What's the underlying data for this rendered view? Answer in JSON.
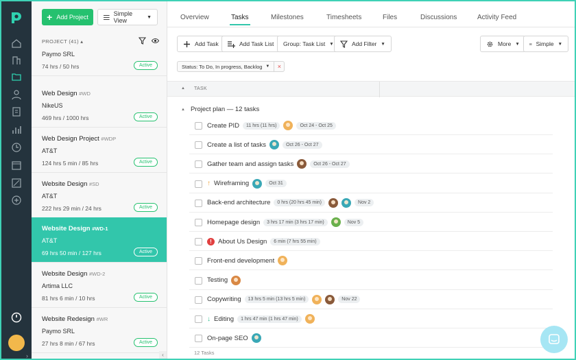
{
  "colors": {
    "accent": "#32c6ab",
    "green": "#25c16f",
    "nav_bg": "#24333d",
    "danger": "#e14040"
  },
  "nav": {
    "icons": [
      "home-icon",
      "building-icon",
      "folder-icon",
      "user-icon",
      "invoice-icon",
      "chart-icon",
      "clock-icon",
      "calendar-icon",
      "report-icon",
      "add-circle-icon",
      "timer-icon"
    ]
  },
  "sidebar": {
    "add_project_label": "Add Project",
    "view_label": "Simple View",
    "project_header": "PROJECT (41)",
    "projects": [
      {
        "name": "",
        "code": "",
        "client": "Paymo SRL",
        "hours": "74 hrs / 50 hrs",
        "status": "Active"
      },
      {
        "name": "Web Design",
        "code": "#WD",
        "client": "NikeUS",
        "hours": "469 hrs / 1000 hrs",
        "status": "Active"
      },
      {
        "name": "Web Design Project",
        "code": "#WDP",
        "client": "AT&T",
        "hours": "124 hrs 5 min / 85 hrs",
        "status": "Active"
      },
      {
        "name": "Website Design",
        "code": "#SD",
        "client": "AT&T",
        "hours": "222 hrs 29 min / 24 hrs",
        "status": "Active"
      },
      {
        "name": "Website Design",
        "code": "#WD-1",
        "client": "AT&T",
        "hours": "69 hrs 50 min / 127 hrs",
        "status": "Active"
      },
      {
        "name": "Website Design",
        "code": "#WD-2",
        "client": "Artima LLC",
        "hours": "81 hrs 6 min / 10 hrs",
        "status": "Active"
      },
      {
        "name": "Website Redesign",
        "code": "#WR",
        "client": "Paymo SRL",
        "hours": "27 hrs 8 min / 67 hrs",
        "status": "Active"
      }
    ]
  },
  "main": {
    "tabs": [
      "Overview",
      "Tasks",
      "Milestones",
      "Timesheets",
      "Files",
      "Discussions",
      "Activity Feed"
    ],
    "toolbar": {
      "add_task": "Add Task",
      "add_task_list": "Add Task List",
      "group": "Group: Task List",
      "add_filter": "Add Filter",
      "more": "More",
      "simple": "Simple"
    },
    "filter_chip": "Status: To Do, In progress, Backlog",
    "column_task": "TASK",
    "group_label": "Project plan — 12 tasks",
    "tasks": [
      {
        "name": "Create PID",
        "time": "11 hrs (11 hrs)",
        "date": "Oct 24 - Oct 25"
      },
      {
        "name": "Create a list of tasks",
        "time": "",
        "date": "Oct 26 - Oct 27"
      },
      {
        "name": "Gather team and assign tasks",
        "time": "",
        "date": "Oct 26 - Oct 27"
      },
      {
        "name": "Wireframing",
        "time": "",
        "date": "Oct 31"
      },
      {
        "name": "Back-end architecture",
        "time": "0 hrs (20 hrs 45 min)",
        "date": "Nov 2"
      },
      {
        "name": "Homepage design",
        "time": "3 hrs 17 min (3 hrs 17 min)",
        "date": "Nov 5"
      },
      {
        "name": "About Us Design",
        "time": "6 min (7 hrs 55 min)",
        "date": ""
      },
      {
        "name": "Front-end development",
        "time": "",
        "date": ""
      },
      {
        "name": "Testing",
        "time": "",
        "date": ""
      },
      {
        "name": "Copywriting",
        "time": "13 hrs 5 min (13 hrs 5 min)",
        "date": "Nov 22"
      },
      {
        "name": "Editing",
        "time": "1 hrs 47 min (1 hrs 47 min)",
        "date": ""
      },
      {
        "name": "On-page SEO",
        "time": "",
        "date": ""
      }
    ],
    "task_count": "12 Tasks"
  }
}
